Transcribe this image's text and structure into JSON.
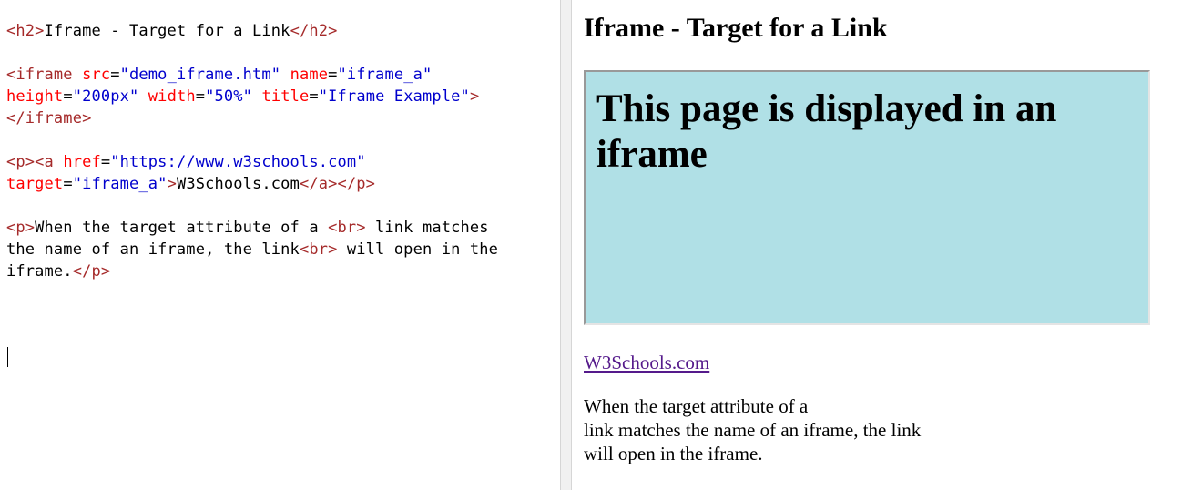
{
  "editor": {
    "lines": [
      [
        {
          "t": "tag",
          "v": "<h2>"
        },
        {
          "t": "text",
          "v": "Iframe - Target for a Link"
        },
        {
          "t": "tag",
          "v": "</h2>"
        }
      ],
      [],
      [
        {
          "t": "tag",
          "v": "<iframe "
        },
        {
          "t": "attr",
          "v": "src"
        },
        {
          "t": "text",
          "v": "="
        },
        {
          "t": "val",
          "v": "\"demo_iframe.htm\""
        },
        {
          "t": "text",
          "v": " "
        },
        {
          "t": "attr",
          "v": "name"
        },
        {
          "t": "text",
          "v": "="
        },
        {
          "t": "val",
          "v": "\"iframe_a\""
        }
      ],
      [
        {
          "t": "attr",
          "v": "height"
        },
        {
          "t": "text",
          "v": "="
        },
        {
          "t": "val",
          "v": "\"200px\""
        },
        {
          "t": "text",
          "v": " "
        },
        {
          "t": "attr",
          "v": "width"
        },
        {
          "t": "text",
          "v": "="
        },
        {
          "t": "val",
          "v": "\"50%\""
        },
        {
          "t": "text",
          "v": " "
        },
        {
          "t": "attr",
          "v": "title"
        },
        {
          "t": "text",
          "v": "="
        },
        {
          "t": "val",
          "v": "\"Iframe Example\""
        },
        {
          "t": "tag",
          "v": ">"
        }
      ],
      [
        {
          "t": "tag",
          "v": "</iframe>"
        }
      ],
      [],
      [
        {
          "t": "tag",
          "v": "<p><a "
        },
        {
          "t": "attr",
          "v": "href"
        },
        {
          "t": "text",
          "v": "="
        },
        {
          "t": "val",
          "v": "\"https://www.w3schools.com\""
        }
      ],
      [
        {
          "t": "attr",
          "v": "target"
        },
        {
          "t": "text",
          "v": "="
        },
        {
          "t": "val",
          "v": "\"iframe_a\""
        },
        {
          "t": "tag",
          "v": ">"
        },
        {
          "t": "text",
          "v": "W3Schools.com"
        },
        {
          "t": "tag",
          "v": "</a></p>"
        }
      ],
      [],
      [
        {
          "t": "tag",
          "v": "<p>"
        },
        {
          "t": "text",
          "v": "When the target attribute of a "
        },
        {
          "t": "tag",
          "v": "<br>"
        },
        {
          "t": "text",
          "v": " link matches"
        }
      ],
      [
        {
          "t": "text",
          "v": "the name of an iframe, the link"
        },
        {
          "t": "tag",
          "v": "<br>"
        },
        {
          "t": "text",
          "v": " will open in the"
        }
      ],
      [
        {
          "t": "text",
          "v": "iframe."
        },
        {
          "t": "tag",
          "v": "</p>"
        }
      ]
    ]
  },
  "preview": {
    "heading": "Iframe - Target for a Link",
    "iframe_content_heading": "This page is displayed in an iframe",
    "link_text": "W3Schools.com",
    "paragraph_lines": [
      "When the target attribute of a",
      "link matches the name of an iframe, the link",
      "will open in the iframe."
    ]
  },
  "colors": {
    "tag": "#a52a2a",
    "attribute": "#ff0000",
    "value": "#0000cd",
    "iframe_background": "#b0e0e6",
    "visited_link": "#551a8b"
  }
}
